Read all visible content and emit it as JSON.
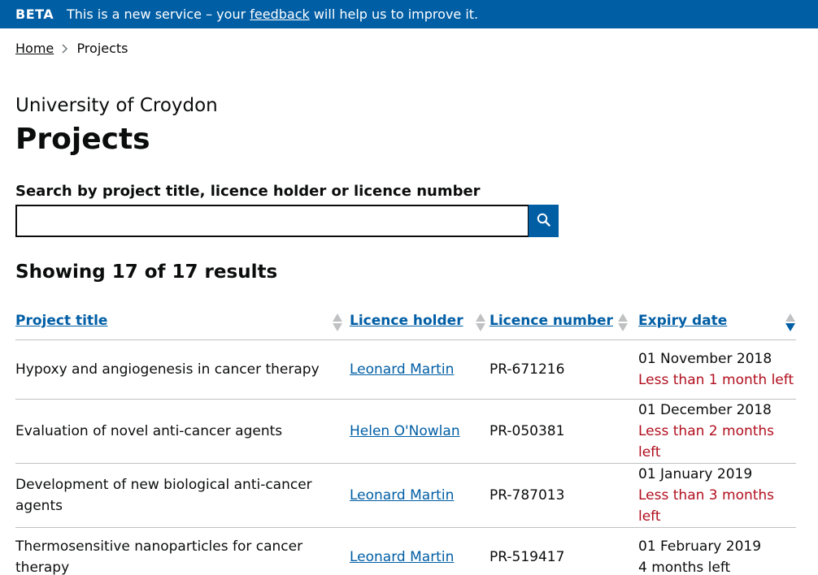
{
  "banner": {
    "tag": "BETA",
    "text_before": "This is a new service – your",
    "link": "feedback",
    "text_after": "will help us to improve it."
  },
  "breadcrumb": {
    "home": "Home",
    "current": "Projects"
  },
  "establishment": "University of Croydon",
  "title": "Projects",
  "search": {
    "label": "Search by project title, licence holder or licence number",
    "value": "",
    "placeholder": ""
  },
  "results": "Showing 17 of 17 results",
  "table": {
    "headers": {
      "title": "Project title",
      "holder": "Licence holder",
      "number": "Licence number",
      "expiry": "Expiry date"
    },
    "sorted_column": "expiry",
    "sort_direction": "ascending",
    "rows": [
      {
        "title": "Hypoxy and angiogenesis in cancer therapy",
        "holder": "Leonard Martin",
        "number": "PR-671216",
        "expiry": "01 November 2018",
        "remaining": "Less than 1 month left",
        "warning": true
      },
      {
        "title": "Evaluation of novel anti-cancer agents",
        "holder": "Helen O'Nowlan",
        "number": "PR-050381",
        "expiry": "01 December 2018",
        "remaining": "Less than 2 months left",
        "warning": true
      },
      {
        "title": "Development of new biological anti-cancer agents",
        "holder": "Leonard Martin",
        "number": "PR-787013",
        "expiry": "01 January 2019",
        "remaining": "Less than 3 months left",
        "warning": true
      },
      {
        "title": "Thermosensitive nanoparticles for cancer therapy",
        "holder": "Leonard Martin",
        "number": "PR-519417",
        "expiry": "01 February 2019",
        "remaining": "4 months left",
        "warning": false
      }
    ]
  },
  "colors": {
    "brand": "#005ea5",
    "link": "#005ea5",
    "warning": "#b10e1e",
    "text": "#0b0c0c"
  },
  "icons": {
    "search": "search-icon",
    "breadcrumb_separator": "chevron-right-icon",
    "sort": "sort-arrows-icon"
  }
}
